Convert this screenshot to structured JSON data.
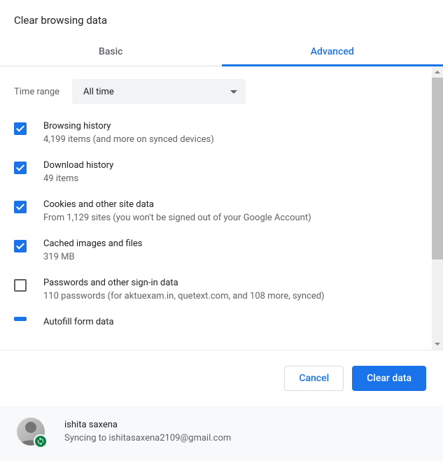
{
  "title": "Clear browsing data",
  "tabs": {
    "basic": "Basic",
    "advanced": "Advanced"
  },
  "time": {
    "label": "Time range",
    "value": "All time"
  },
  "items": [
    {
      "title": "Browsing history",
      "desc": "4,199 items (and more on synced devices)",
      "checked": true
    },
    {
      "title": "Download history",
      "desc": "49 items",
      "checked": true
    },
    {
      "title": "Cookies and other site data",
      "desc": "From 1,129 sites (you won't be signed out of your Google Account)",
      "checked": true
    },
    {
      "title": "Cached images and files",
      "desc": "319 MB",
      "checked": true
    },
    {
      "title": "Passwords and other sign-in data",
      "desc": "110 passwords (for aktuexam.in, quetext.com, and 108 more, synced)",
      "checked": false
    },
    {
      "title": "Autofill form data",
      "desc": "",
      "checked": true
    }
  ],
  "actions": {
    "cancel": "Cancel",
    "clear": "Clear data"
  },
  "account": {
    "name": "ishita saxena",
    "status": "Syncing to ishitasaxena2109@gmail.com"
  }
}
